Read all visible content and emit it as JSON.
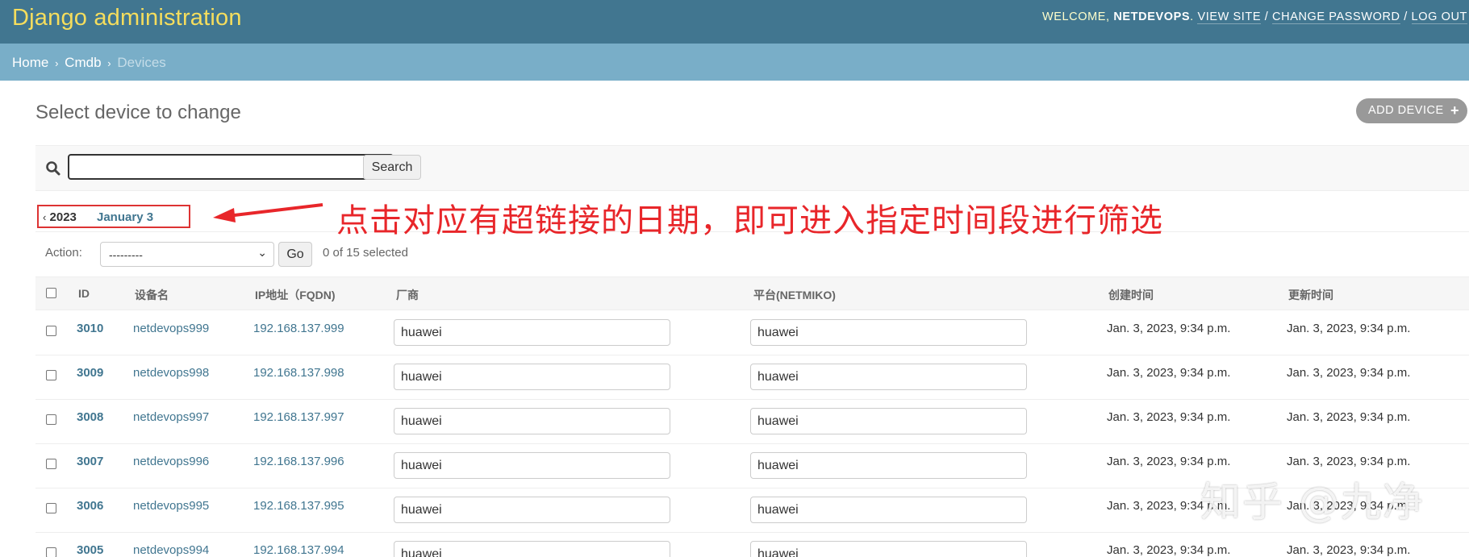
{
  "header": {
    "brand": "Django administration",
    "welcome_prefix": "WELCOME, ",
    "username": "NETDEVOPS",
    "welcome_suffix": ". ",
    "view_site": "VIEW SITE",
    "change_password": "CHANGE PASSWORD",
    "log_out": "LOG OUT",
    "separator": " / "
  },
  "breadcrumbs": {
    "home": "Home",
    "app": "Cmdb",
    "current": "Devices",
    "arrow": "›"
  },
  "page": {
    "title": "Select device to change",
    "add_button": "ADD DEVICE",
    "add_icon": "+"
  },
  "search": {
    "value": "",
    "button": "Search",
    "icon": "search-icon"
  },
  "date_hierarchy": {
    "back_glyph": "‹",
    "year": "2023",
    "month": "January 3"
  },
  "annotation": {
    "text": "点击对应有超链接的日期，即可进入指定时间段进行筛选",
    "color": "#e8262a"
  },
  "actions": {
    "label": "Action:",
    "selected": "---------",
    "go": "Go",
    "count": "0 of 15 selected"
  },
  "table": {
    "headers": [
      "ID",
      "设备名",
      "IP地址（FQDN)",
      "厂商",
      "平台(NETMIKO)",
      "创建时间",
      "更新时间"
    ],
    "rows": [
      {
        "id": "3010",
        "name": "netdevops999",
        "ip": "192.168.137.999",
        "vendor": "huawei",
        "platform": "huawei",
        "created": "Jan. 3, 2023, 9:34 p.m.",
        "updated": "Jan. 3, 2023, 9:34 p.m."
      },
      {
        "id": "3009",
        "name": "netdevops998",
        "ip": "192.168.137.998",
        "vendor": "huawei",
        "platform": "huawei",
        "created": "Jan. 3, 2023, 9:34 p.m.",
        "updated": "Jan. 3, 2023, 9:34 p.m."
      },
      {
        "id": "3008",
        "name": "netdevops997",
        "ip": "192.168.137.997",
        "vendor": "huawei",
        "platform": "huawei",
        "created": "Jan. 3, 2023, 9:34 p.m.",
        "updated": "Jan. 3, 2023, 9:34 p.m."
      },
      {
        "id": "3007",
        "name": "netdevops996",
        "ip": "192.168.137.996",
        "vendor": "huawei",
        "platform": "huawei",
        "created": "Jan. 3, 2023, 9:34 p.m.",
        "updated": "Jan. 3, 2023, 9:34 p.m."
      },
      {
        "id": "3006",
        "name": "netdevops995",
        "ip": "192.168.137.995",
        "vendor": "huawei",
        "platform": "huawei",
        "created": "Jan. 3, 2023, 9:34 p.m.",
        "updated": "Jan. 3, 2023, 9:34 p.m."
      },
      {
        "id": "3005",
        "name": "netdevops994",
        "ip": "192.168.137.994",
        "vendor": "huawei",
        "platform": "huawei",
        "created": "Jan. 3, 2023, 9:34 p.m.",
        "updated": "Jan. 3, 2023, 9:34 p.m."
      }
    ]
  },
  "watermark": "知乎 @九净",
  "colors": {
    "header_bg": "#417690",
    "brand": "#f5dd5d",
    "breadcrumbs_bg": "#79aec8",
    "link": "#417690"
  }
}
